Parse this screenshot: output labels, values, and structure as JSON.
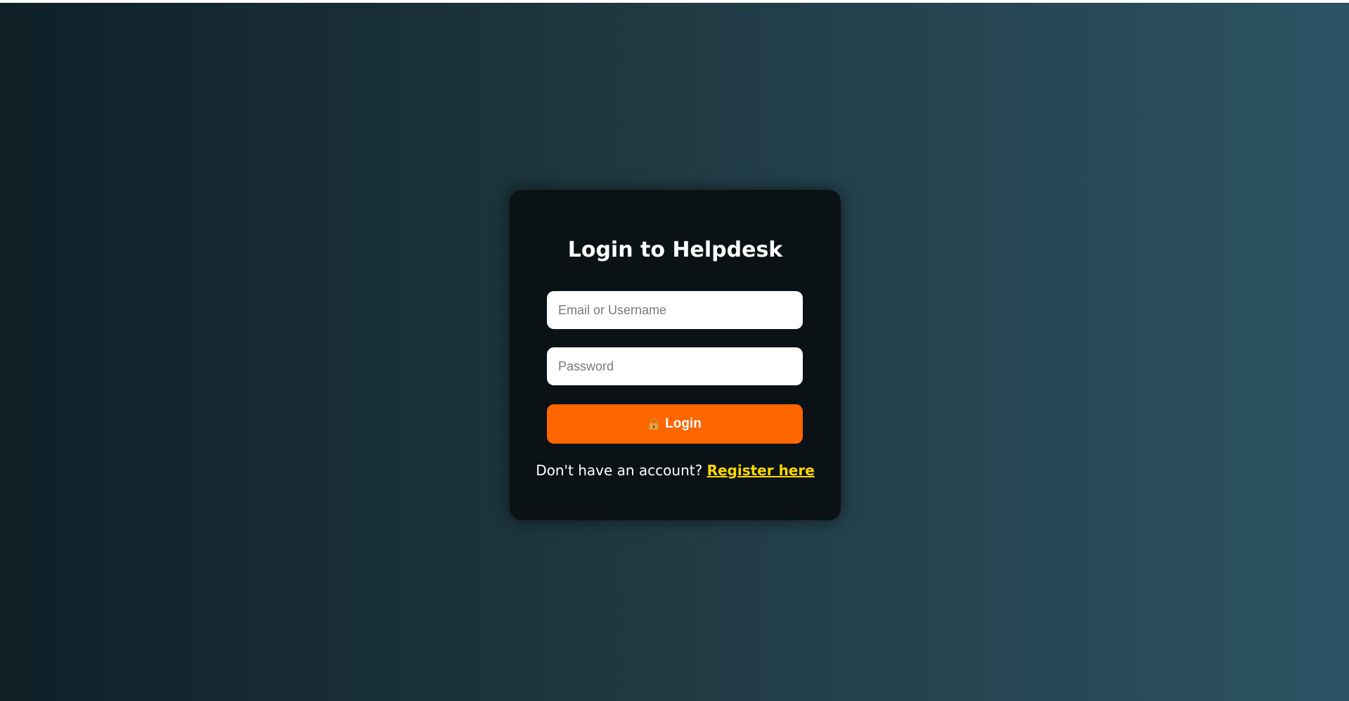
{
  "login_card": {
    "title": "Login to Helpdesk",
    "email_field": {
      "placeholder": "Email or Username",
      "value": ""
    },
    "password_field": {
      "placeholder": "Password",
      "value": ""
    },
    "login_button": {
      "label": "Login",
      "icon": "lock-icon"
    },
    "register_prompt": {
      "text": "Don't have an account?",
      "link_label": "Register here"
    }
  },
  "colors": {
    "background_gradient": [
      "#0f2027",
      "#203a43",
      "#2c5364"
    ],
    "card_background": "#0a1216",
    "button_accent": "#ff6600",
    "link_color": "#ffd700"
  }
}
